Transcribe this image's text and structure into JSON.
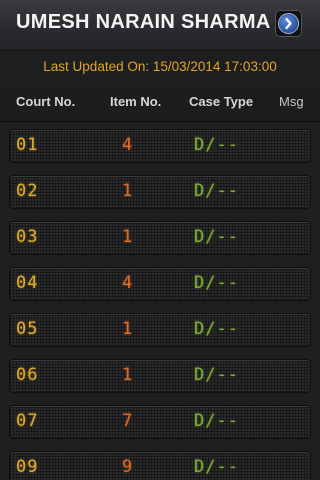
{
  "header": {
    "title": "UMESH NARAIN SHARMA",
    "next_icon": "chevron-right-icon"
  },
  "status": {
    "last_updated": "Last Updated On: 15/03/2014 17:03:00"
  },
  "colors": {
    "court_no": "#e0ab2a",
    "item_no": "#df6b24",
    "case_type": "#7fae2e",
    "last_updated": "#e5a324"
  },
  "table": {
    "columns": [
      "Court No.",
      "Item No.",
      "Case Type",
      "Msg"
    ],
    "rows": [
      {
        "court": "01",
        "item": "4",
        "case_type": "D/--"
      },
      {
        "court": "02",
        "item": "1",
        "case_type": "D/--"
      },
      {
        "court": "03",
        "item": "1",
        "case_type": "D/--"
      },
      {
        "court": "04",
        "item": "4",
        "case_type": "D/--"
      },
      {
        "court": "05",
        "item": "1",
        "case_type": "D/--"
      },
      {
        "court": "06",
        "item": "1",
        "case_type": "D/--"
      },
      {
        "court": "07",
        "item": "7",
        "case_type": "D/--"
      },
      {
        "court": "09",
        "item": "9",
        "case_type": "D/--"
      }
    ]
  }
}
